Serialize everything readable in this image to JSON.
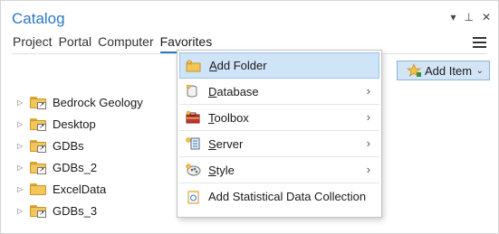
{
  "pane": {
    "title": "Catalog",
    "controls": [
      "▾",
      "⊥",
      "✕"
    ]
  },
  "tabs": [
    {
      "label": "Project",
      "active": false
    },
    {
      "label": "Portal",
      "active": false
    },
    {
      "label": "Computer",
      "active": false
    },
    {
      "label": "Favorites",
      "active": true
    }
  ],
  "toolbar": {
    "add_item_label": "Add Item",
    "add_item_icon": "add-item-star-icon"
  },
  "tree": {
    "items": [
      {
        "label": "Bedrock Geology",
        "icon": "folder-link-icon"
      },
      {
        "label": "Desktop",
        "icon": "folder-link-icon"
      },
      {
        "label": "GDBs",
        "icon": "folder-link-icon"
      },
      {
        "label": "GDBs_2",
        "icon": "folder-link-icon"
      },
      {
        "label": "ExcelData",
        "icon": "folder-icon"
      },
      {
        "label": "GDBs_3",
        "icon": "folder-link-icon"
      }
    ]
  },
  "menu": {
    "items": [
      {
        "accel": "A",
        "rest": "dd Folder",
        "submenu": false,
        "highlighted": true,
        "icon": "add-folder-icon"
      },
      {
        "accel": "D",
        "rest": "atabase",
        "submenu": true,
        "highlighted": false,
        "icon": "database-icon"
      },
      {
        "accel": "T",
        "rest": "oolbox",
        "submenu": true,
        "highlighted": false,
        "icon": "toolbox-icon"
      },
      {
        "accel": "S",
        "rest": "erver",
        "submenu": true,
        "highlighted": false,
        "icon": "server-icon"
      },
      {
        "accel": "S",
        "rest": "tyle",
        "submenu": true,
        "highlighted": false,
        "icon": "style-icon"
      },
      {
        "accel": "",
        "rest": "Add Statistical Data Collection",
        "submenu": false,
        "highlighted": false,
        "icon": "statistical-data-icon"
      }
    ]
  },
  "colors": {
    "accent": "#2b79c2",
    "highlight": "#cfe4f7",
    "folder": "#f2c65a"
  }
}
